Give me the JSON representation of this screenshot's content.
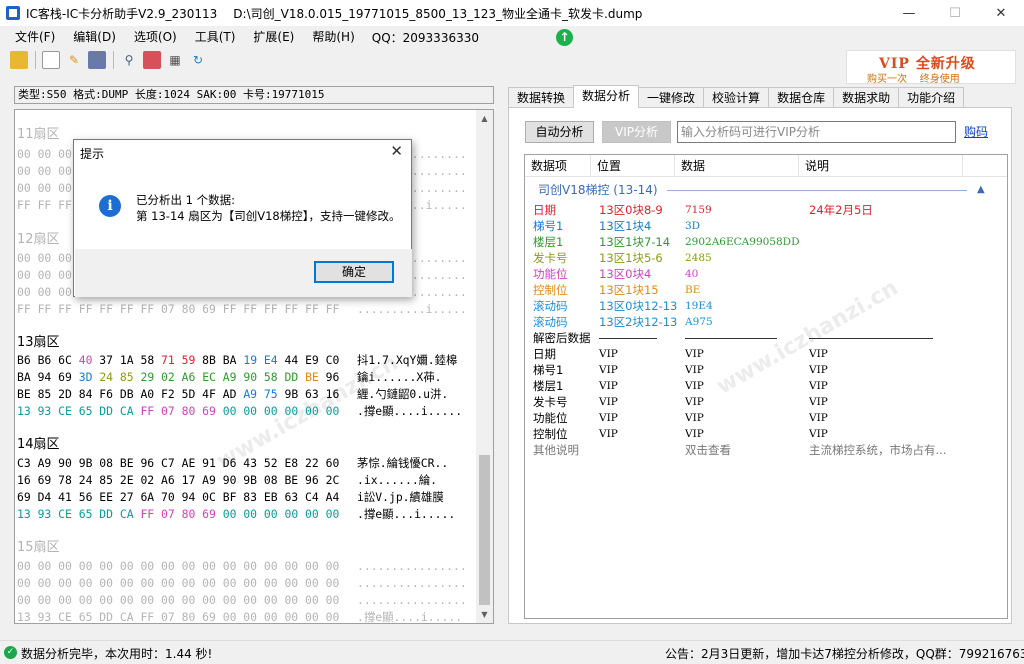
{
  "window": {
    "app_name": "IC客栈-IC卡分析助手V2.9_230113",
    "file_path": "D:\\司创_V18.0.015_19771015_8500_13_123_物业全通卡_软发卡.dump",
    "minimize": "—",
    "maximize": "☐",
    "close": "✕"
  },
  "menu": {
    "items": [
      "文件(F)",
      "编辑(D)",
      "选项(O)",
      "工具(T)",
      "扩展(E)",
      "帮助(H)"
    ],
    "qq": "QQ：2093336330"
  },
  "vip_banner": {
    "line1": "VIP 全新升级",
    "line2": "购买一次    终身使用"
  },
  "card_info": "类型:S50 格式:DUMP 长度:1024 SAK:00 卡号:19771015",
  "sectors": {
    "s11": {
      "title": "11扇区",
      "lines": [
        "00 00 00 00 00 00 00 00 00 00 00 00 00 00 00 00",
        "00 00 00 00 00 00 00 00 00 00 00 00 00 00 00 00",
        "00 00 00 00 00 00 00 00 00 00 00 00 00 00 00 00",
        "FF FF FF FF FF FF FF 07 80 69 FF FF FF FF FF FF"
      ],
      "ascii": [
        "................",
        "................",
        "................",
        "..........i....."
      ]
    },
    "s12": {
      "title": "12扇区",
      "lines": [
        "00 00 00 00 00 00 00 00 00 00 00 00 00 00 00 00",
        "00 00 00 00 00 00 00 00 00 00 00 00 00 00 00 00",
        "00 00 00 00 00 00 00 00 00 00 00 00 00 00 00 00",
        "FF FF FF FF FF FF FF 07 80 69 FF FF FF FF FF FF"
      ],
      "ascii": [
        "................",
        "................",
        "................",
        "..........i....."
      ]
    },
    "s13": {
      "title": "13扇区",
      "ascii": [
        "抖1.7.XqY嬭.錴槔",
        "鑰i......X茽.",
        "緾.勺鏈鼦0.u汫.",
        ".撐e顯....i....."
      ]
    },
    "s14": {
      "title": "14扇区",
      "lines": [
        "C3 A9 90 9B 08 BE 96 C7 AE 91 D6 43 52 E8 22 60",
        "16 69 78 24 85 2E 02 A6 17 A9 90 9B 08 BE 96 2C",
        "69 D4 41 56 EE 27 6A 70 94 0C BF 83 EB 63 C4 A4"
      ],
      "ascii": [
        "茅悰.綸钱懮CR..",
        ".ix......綸.",
        "i訟V.jp.繢雄膜",
        ".撐e顯...i....."
      ]
    },
    "s15": {
      "title": "15扇区",
      "lines": [
        "00 00 00 00 00 00 00 00 00 00 00 00 00 00 00 00",
        "00 00 00 00 00 00 00 00 00 00 00 00 00 00 00 00",
        "00 00 00 00 00 00 00 00 00 00 00 00 00 00 00 00",
        "13 93 CE 65 DD CA FF 07 80 69 00 00 00 00 00 00"
      ],
      "ascii": [
        "................",
        "................",
        "................",
        ".撐e顯....i....."
      ]
    }
  },
  "tabs": [
    "数据转换",
    "数据分析",
    "一键修改",
    "校验计算",
    "数据仓库",
    "数据求助",
    "功能介绍"
  ],
  "analysis": {
    "auto_button": "自动分析",
    "vip_button": "VIP分析",
    "search_placeholder": "输入分析码可进行VIP分析",
    "buy_link": "购码",
    "headers": [
      "数据项",
      "位置",
      "数据",
      "说明"
    ],
    "group": "司创V18梯控 (13-14)",
    "group_caret": "▲",
    "rows": [
      {
        "item": "日期",
        "pos": "13区0块8-9",
        "data": "7159",
        "desc": "24年2月5日",
        "color": "#e0202a"
      },
      {
        "item": "梯号1",
        "pos": "13区1块4",
        "data": "3D",
        "desc": "",
        "color": "#1878d8"
      },
      {
        "item": "楼层1",
        "pos": "13区1块7-14",
        "data": "2902A6ECA99058DD",
        "desc": "",
        "color": "#309830"
      },
      {
        "item": "发卡号",
        "pos": "13区1块5-6",
        "data": "2485",
        "desc": "",
        "color": "#8c9c10"
      },
      {
        "item": "功能位",
        "pos": "13区0块4",
        "data": "40",
        "desc": "",
        "color": "#d040c0"
      },
      {
        "item": "控制位",
        "pos": "13区1块15",
        "data": "BE",
        "desc": "",
        "color": "#e08a10"
      },
      {
        "item": "滚动码",
        "pos": "13区0块12-13",
        "data": "19E4",
        "desc": "",
        "color": "#1890d8"
      },
      {
        "item": "滚动码",
        "pos": "13区2块12-13",
        "data": "A975",
        "desc": "",
        "color": "#1890d8"
      }
    ],
    "decrypted_label": "解密后数据",
    "decrypted_rows": [
      {
        "item": "日期",
        "pos": "VIP",
        "data": "VIP",
        "desc": "VIP"
      },
      {
        "item": "梯号1",
        "pos": "VIP",
        "data": "VIP",
        "desc": "VIP"
      },
      {
        "item": "楼层1",
        "pos": "VIP",
        "data": "VIP",
        "desc": "VIP"
      },
      {
        "item": "发卡号",
        "pos": "VIP",
        "data": "VIP",
        "desc": "VIP"
      },
      {
        "item": "功能位",
        "pos": "VIP",
        "data": "VIP",
        "desc": "VIP"
      },
      {
        "item": "控制位",
        "pos": "VIP",
        "data": "VIP",
        "desc": "VIP"
      }
    ],
    "other": {
      "item": "其他说明",
      "data": "双击查看",
      "desc": "主流梯控系统，市场占有..."
    }
  },
  "dialog": {
    "title": "提示",
    "line1": "已分析出 1 个数据:",
    "line2": "第 13-14 扇区为【司创V18梯控】，支持一键修改。",
    "ok": "确定"
  },
  "status": {
    "left": "数据分析完毕，本次用时：1.44 秒!",
    "notice": "公告：2月3日更新，增加卡达7梯控分析修改，QQ群：799216763"
  }
}
